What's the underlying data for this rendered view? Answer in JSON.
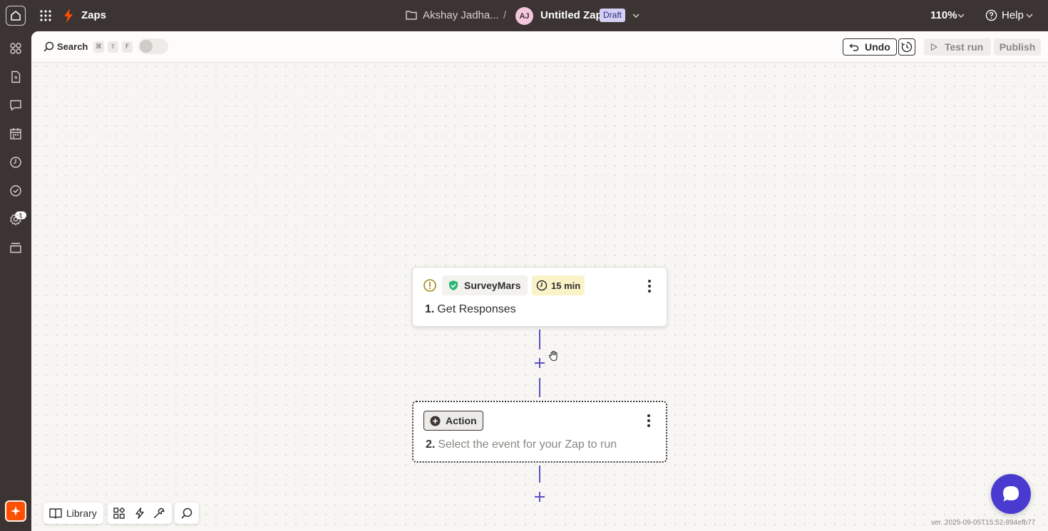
{
  "topbar": {
    "app_label": "Zaps",
    "owner": "Akshay Jadha...",
    "separator": "/",
    "avatar_initials": "AJ",
    "zap_title": "Untitled Zap",
    "status_badge": "Draft",
    "zoom": "110%",
    "help_label": "Help"
  },
  "sidebar": {
    "notification_count": "1",
    "items": [
      "apps-icon",
      "file-zap-icon",
      "chat-icon",
      "calendar-icon",
      "clock-icon",
      "notifications-icon",
      "settings-icon",
      "layers-icon"
    ]
  },
  "toolbar": {
    "search_label": "Search",
    "shortcut_keys": [
      "⌘",
      "⇧",
      "F"
    ],
    "undo_label": "Undo",
    "test_run_label": "Test run",
    "publish_label": "Publish"
  },
  "steps": [
    {
      "app": "SurveyMars",
      "schedule": "15 min",
      "number": "1.",
      "title": "Get Responses"
    },
    {
      "chip": "Action",
      "number": "2.",
      "title": "Select the event for your Zap to run"
    }
  ],
  "bottom_tools": {
    "library_label": "Library"
  },
  "version": "ver. 2025-09-05T15:52-894efb77",
  "colors": {
    "brand_orange": "#ff4f00",
    "connector": "#5b4fc9",
    "chat_button": "#4a3bd0",
    "topbar": "#3b3433"
  }
}
